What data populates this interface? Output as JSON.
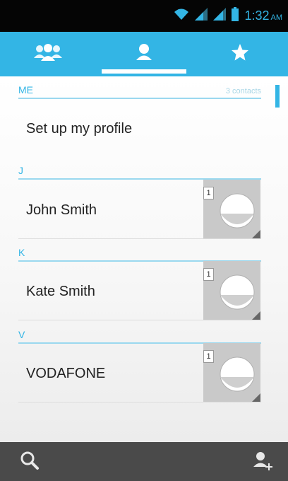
{
  "status_bar": {
    "time": "1:32",
    "ampm": "AM",
    "wifi_icon": "wifi-icon",
    "signal_icons": [
      "signal-icon",
      "signal-icon"
    ],
    "battery_icon": "battery-icon"
  },
  "tabs": [
    {
      "name": "groups",
      "icon": "groups-icon",
      "active": false
    },
    {
      "name": "contacts",
      "icon": "person-icon",
      "active": true
    },
    {
      "name": "favorites",
      "icon": "star-icon",
      "active": false
    }
  ],
  "me_section": {
    "label": "ME",
    "count": "3 contacts",
    "setup_label": "Set up my profile"
  },
  "contacts": [
    {
      "letter": "J",
      "name": "John Smith",
      "badge": "1"
    },
    {
      "letter": "K",
      "name": "Kate Smith",
      "badge": "1"
    },
    {
      "letter": "V",
      "name": "VODAFONE",
      "badge": "1"
    }
  ],
  "bottom_bar": {
    "search_icon": "search-icon",
    "add_contact_icon": "add-contact-icon"
  },
  "colors": {
    "accent": "#33b5e5",
    "status_bar_bg": "#050505",
    "bottom_bar_bg": "#4a4a4a",
    "avatar_bg": "#c9c9c9"
  }
}
